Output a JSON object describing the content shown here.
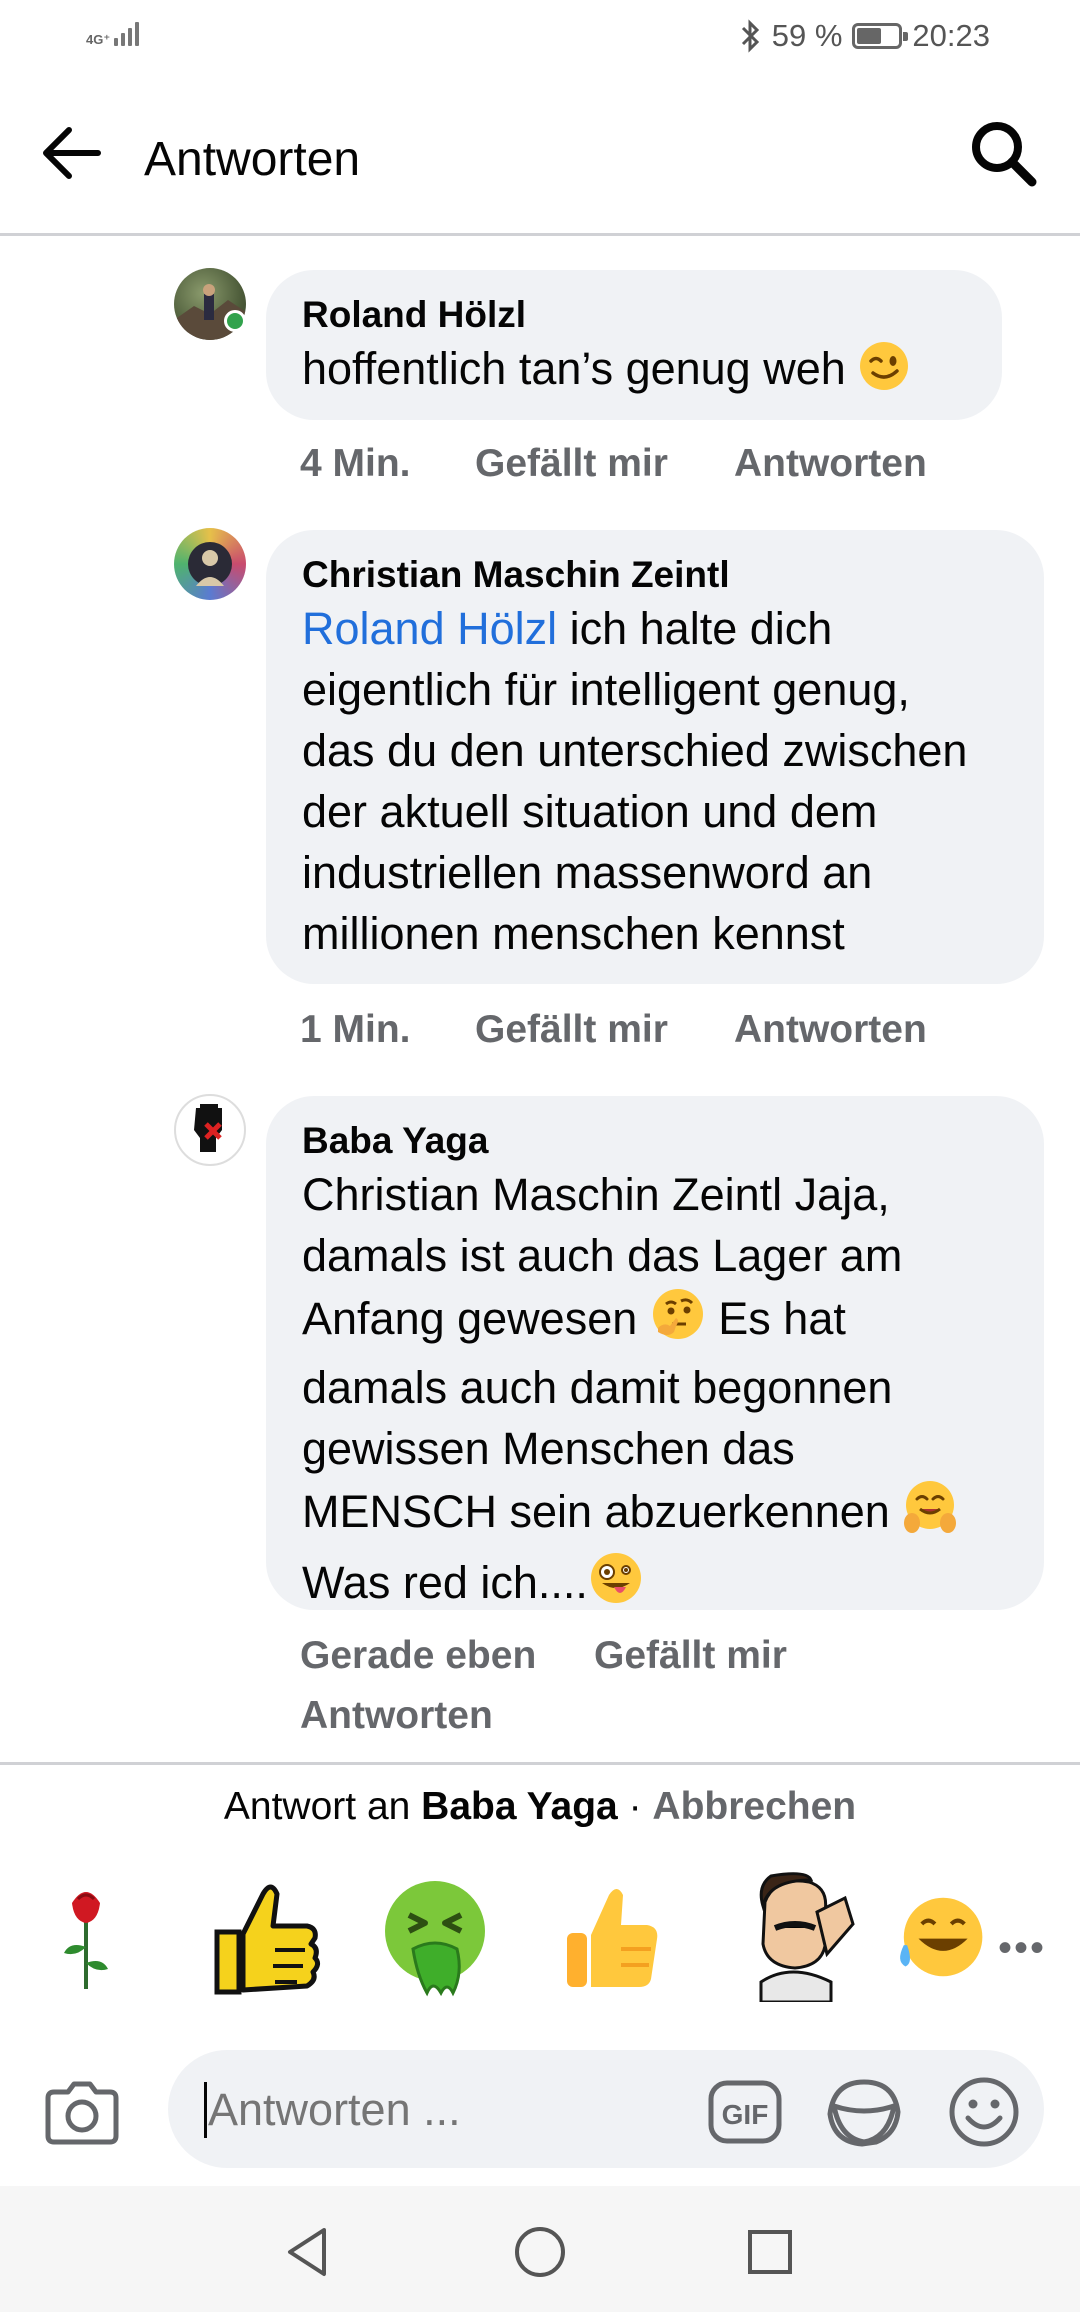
{
  "status_bar": {
    "network": "4G⁺",
    "battery_text": "59 %",
    "battery_level": 0.59,
    "time": "20:23"
  },
  "app_bar": {
    "title": "Antworten",
    "back_icon": "arrow-left-icon",
    "search_icon": "search-icon"
  },
  "comments": [
    {
      "author": "Roland Hölzl",
      "avatar_icon": "avatar-photo",
      "online": true,
      "mention": "",
      "text": "hoffentlich tan’s genug weh",
      "emoji": "wink-emoji",
      "time": "4 Min.",
      "like": "Gefällt mir",
      "reply": "Antworten"
    },
    {
      "author": "Christian Maschin Zeintl",
      "avatar_icon": "avatar-photo",
      "mention": "Roland Hölzl",
      "text_lines": [
        " ich halte dich",
        "eigentlich für intelligent genug,",
        "das du den unterschied zwischen",
        "der aktuell situation und dem",
        "industriellen massenword an",
        "millionen menschen kennst"
      ],
      "time": "1 Min.",
      "like": "Gefällt mir",
      "reply": "Antworten"
    },
    {
      "author": "Baba Yaga",
      "avatar_icon": "raised-fist-avatar",
      "line1": "Christian Maschin Zeintl Jaja,",
      "line2": "damals ist auch das Lager am",
      "line3": "Anfang gewesen",
      "line3_emoji": "thinking-face-emoji",
      "line3_after": " Es hat",
      "line4": "damals auch damit begonnen",
      "line5": "gewissen Menschen das",
      "line6": "MENSCH sein abzuerkennen",
      "line6_emoji": "hugging-face-emoji",
      "line7": "Was red ich....",
      "line7_emoji": "zany-face-emoji",
      "time": "Gerade eben",
      "like": "Gefällt mir",
      "reply": "Antworten"
    }
  ],
  "reply_bar": {
    "prefix": "Antwort an ",
    "name": "Baba Yaga",
    "separator": " · ",
    "cancel": "Abbrechen"
  },
  "stickers": [
    "rose-sticker",
    "thumbs-up-drawn-sticker",
    "vomiting-face-sticker",
    "thumbs-up-sticker",
    "facepalm-man-sticker",
    "laughing-tears-sticker"
  ],
  "more_icon": "more-dots-icon",
  "more_label": "•••",
  "composer": {
    "camera_icon": "camera-icon",
    "placeholder": "Antworten ...",
    "gif_label": "GIF",
    "sticker_icon": "sticker-icon",
    "emoji_icon": "smiley-icon"
  },
  "nav": {
    "back": "nav-back-icon",
    "home": "nav-home-icon",
    "recents": "nav-recents-icon"
  }
}
